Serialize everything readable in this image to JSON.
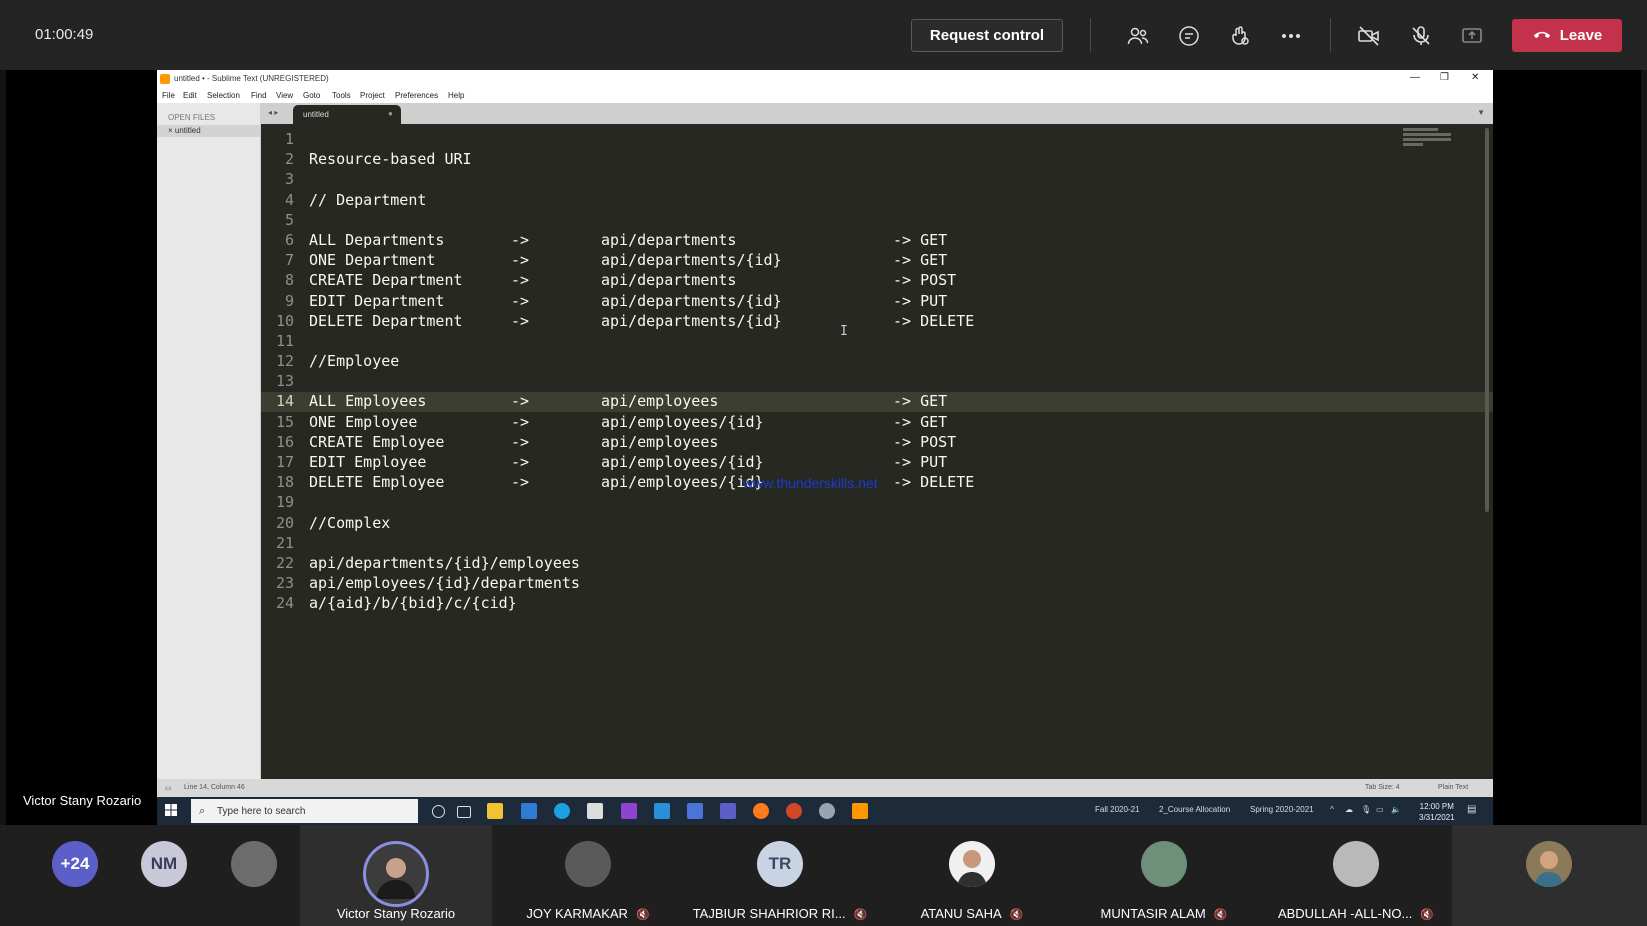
{
  "meeting": {
    "timer": "01:00:49",
    "request_control": "Request control",
    "leave": "Leave",
    "presenter_name": "Victor Stany Rozario",
    "icons": [
      "people-icon",
      "chat-icon",
      "reactions-icon",
      "more-icon",
      "camera-off-icon",
      "mic-off-icon",
      "share-icon"
    ]
  },
  "sublime": {
    "title": "untitled • - Sublime Text (UNREGISTERED)",
    "menu": [
      "File",
      "Edit",
      "Selection",
      "Find",
      "View",
      "Goto",
      "Tools",
      "Project",
      "Preferences",
      "Help"
    ],
    "open_files_header": "OPEN FILES",
    "open_file": "untitled",
    "tab_label": "untitled",
    "current_line": 14,
    "lines": [
      [
        "",
        "",
        "",
        ""
      ],
      [
        "Resource-based URI",
        "",
        "",
        ""
      ],
      [
        "",
        "",
        "",
        ""
      ],
      [
        "// Department",
        "",
        "",
        ""
      ],
      [
        "",
        "",
        "",
        ""
      ],
      [
        "ALL Departments",
        "->",
        "api/departments",
        "-> GET"
      ],
      [
        "ONE Department",
        "->",
        "api/departments/{id}",
        "-> GET"
      ],
      [
        "CREATE Department",
        "->",
        "api/departments",
        "-> POST"
      ],
      [
        "EDIT Department",
        "->",
        "api/departments/{id}",
        "-> PUT"
      ],
      [
        "DELETE Department",
        "->",
        "api/departments/{id}",
        "-> DELETE"
      ],
      [
        "",
        "",
        "",
        ""
      ],
      [
        "//Employee",
        "",
        "",
        ""
      ],
      [
        "",
        "",
        "",
        ""
      ],
      [
        "ALL Employees",
        "->",
        "api/employees",
        "-> GET"
      ],
      [
        "ONE Employee",
        "->",
        "api/employees/{id}",
        "-> GET"
      ],
      [
        "CREATE Employee",
        "->",
        "api/employees",
        "-> POST"
      ],
      [
        "EDIT Employee",
        "->",
        "api/employees/{id}",
        "-> PUT"
      ],
      [
        "DELETE Employee",
        "->",
        "api/employees/{id}",
        "-> DELETE"
      ],
      [
        "",
        "",
        "",
        ""
      ],
      [
        "//Complex",
        "",
        "",
        ""
      ],
      [
        "",
        "",
        "",
        ""
      ],
      [
        "api/departments/{id}/employees",
        "",
        "",
        ""
      ],
      [
        "api/employees/{id}/departments",
        "",
        "",
        ""
      ],
      [
        "a/{aid}/b/{bid}/c/{cid}",
        "",
        "",
        ""
      ]
    ],
    "watermark": "www.thunderskills.net",
    "status_left": "Line 14, Column 46",
    "status_tab": "Tab Size: 4",
    "status_syntax": "Plain Text"
  },
  "taskbar": {
    "search_placeholder": "Type here to search",
    "tray_items": [
      "Fall 2020-21",
      "2_Course Allocation",
      "Spring 2020-2021"
    ],
    "time": "12:00 PM",
    "date": "3/31/2021"
  },
  "participants": {
    "overflow": "+24",
    "nm_initials": "NM",
    "tr_initials": "TR",
    "names": [
      "Victor Stany Rozario",
      "JOY KARMAKAR",
      "TAJBIUR SHAHRIOR RI...",
      "ATANU SAHA",
      "MUNTASIR ALAM",
      "ABDULLAH -ALL-NO..."
    ]
  },
  "colors": {
    "leave_red": "#c4314b",
    "teams_accent": "#6264a7",
    "editor_bg": "#272822"
  }
}
